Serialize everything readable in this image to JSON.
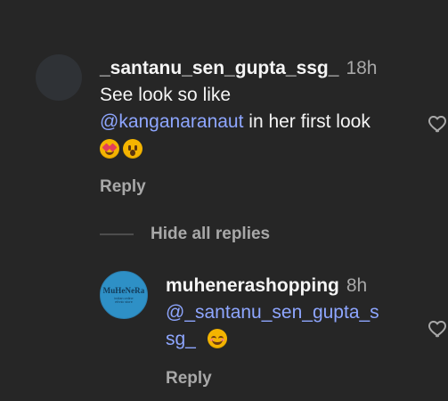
{
  "comment": {
    "username": "_santanu_sen_gupta_ssg_",
    "time": "18h",
    "line1": "See look so like",
    "mention": "@kanganaranaut",
    "line2_suffix": " in her first look",
    "emojis": [
      "heart-eyes-emoji",
      "surprised-face-emoji"
    ],
    "reply_label": "Reply"
  },
  "replies_toggle": {
    "label": "Hide all replies"
  },
  "reply": {
    "username": "muhenerashopping",
    "time": "8h",
    "mention_part1": "@_santanu_sen_gupta_s",
    "mention_part2": "sg_",
    "emoji": "smiling-face-emoji",
    "reply_label": "Reply",
    "avatar_text_top": "MuHeNeRa",
    "avatar_text_bottom": "indian online ethnic store"
  },
  "icons": {
    "like_main": "heart-outline-icon",
    "like_reply": "heart-outline-icon"
  },
  "colors": {
    "background": "#262626",
    "primary_text": "#f5f5f5",
    "secondary_text": "#a8a8a8",
    "mention": "#8ea6ff",
    "reply_avatar_bg": "#2e90c6"
  }
}
